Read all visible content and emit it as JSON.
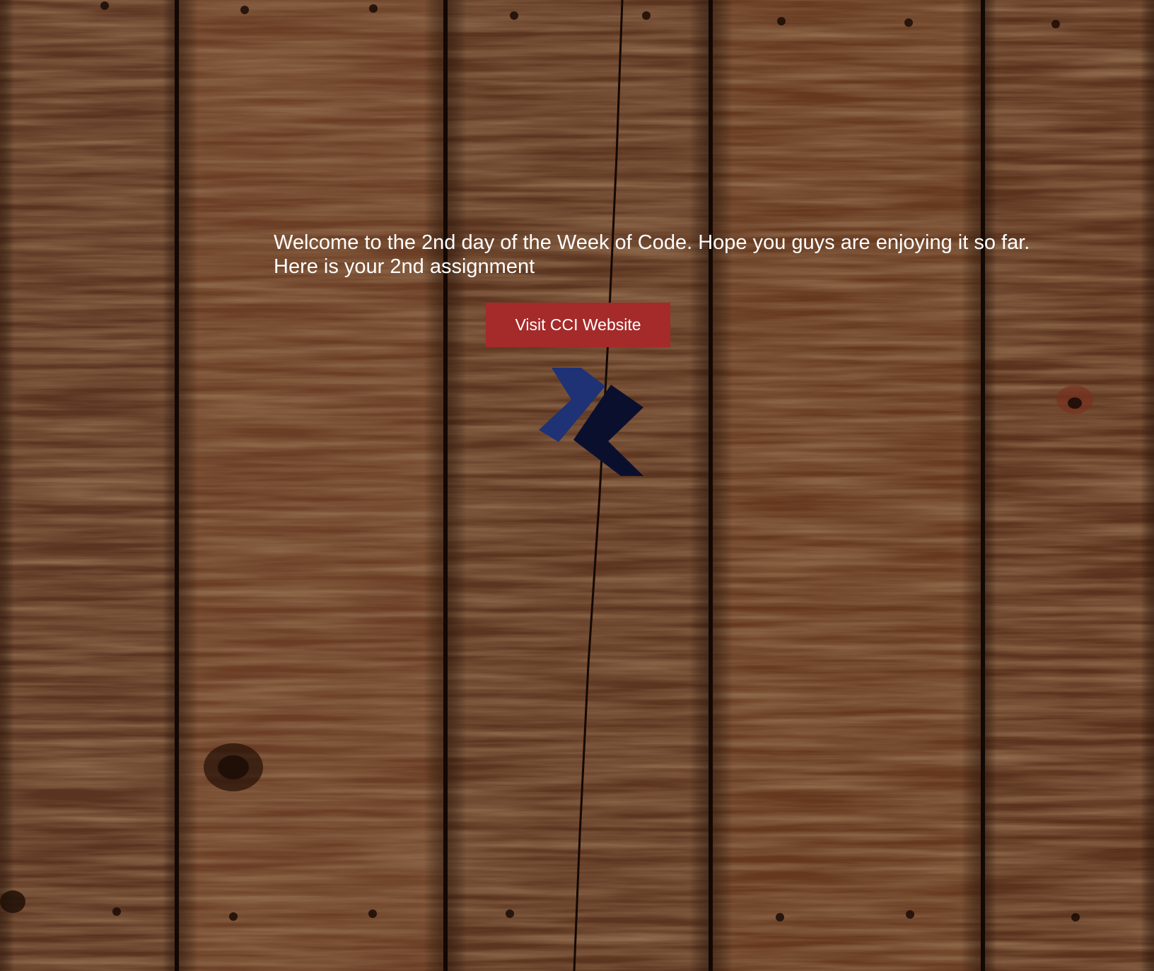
{
  "page": {
    "welcome_line_1": "Welcome to the 2nd day of the Week of Code. Hope you guys are enjoying it so far.",
    "welcome_line_2": "Here is your 2nd assignment"
  },
  "button": {
    "label": "Visit CCI Website",
    "color": "#a52a2a"
  },
  "logo": {
    "icon": "cci-chevron-logo-icon",
    "primary_color": "#1f3275",
    "secondary_color": "#0a0f2e"
  },
  "background": {
    "icon": "wood-plank-texture",
    "base_color": "#4a2a1a"
  }
}
